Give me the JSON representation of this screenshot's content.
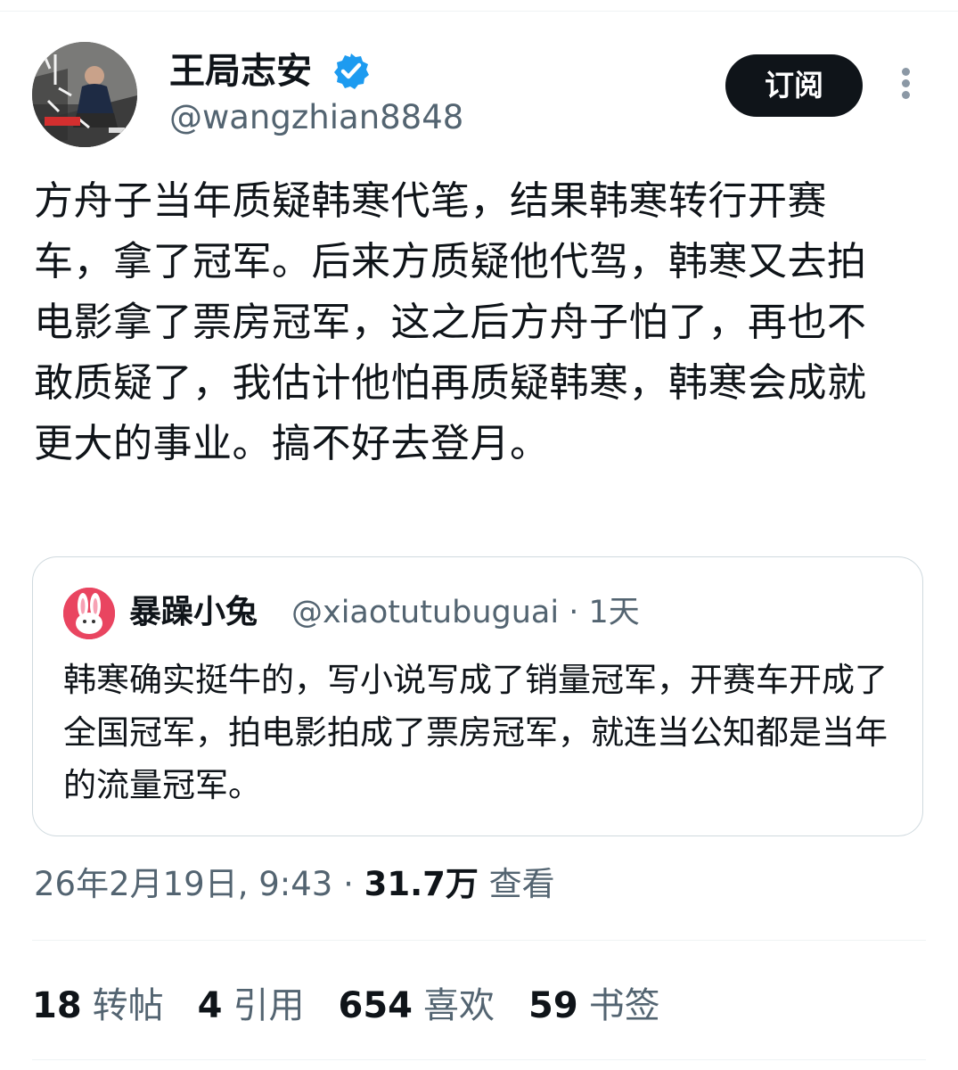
{
  "tweet": {
    "author": {
      "name": "王局志安",
      "handle": "@wangzhian8848",
      "verified": true,
      "avatar": "avatar-photo-man-kneeling"
    },
    "subscribe_label": "订阅",
    "text": "方舟子当年质疑韩寒代笔，结果韩寒转行开赛车，拿了冠军。后来方质疑他代驾，韩寒又去拍电影拿了票房冠军，这之后方舟子怕了，再也不敢质疑了，我估计他怕再质疑韩寒，韩寒会成就更大的事业。搞不好去登月。",
    "quoted": {
      "name": "暴躁小兔",
      "meta": "@xiaotutubuguai · 1天",
      "avatar": "rabbit-icon",
      "text": "韩寒确实挺牛的，写小说写成了销量冠军，开赛车开成了全国冠军，拍电影拍成了票房冠军，就连当公知都是当年的流量冠军。"
    },
    "timestamp": "26年2月19日, 9:43 · ",
    "views": "31.7万",
    "views_label": " 查看",
    "stats": [
      {
        "num": "18",
        "label": "转帖"
      },
      {
        "num": "4",
        "label": "引用"
      },
      {
        "num": "654",
        "label": "喜欢"
      },
      {
        "num": "59",
        "label": "书签"
      }
    ]
  },
  "colors": {
    "verified": "#1d9bf0",
    "text_primary": "#0f1419",
    "text_secondary": "#536471",
    "button_bg": "#0f1419",
    "border": "#cfd9de"
  }
}
